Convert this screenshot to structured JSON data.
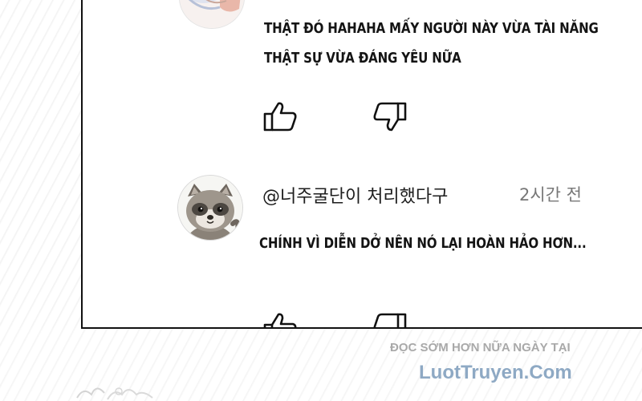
{
  "comments": [
    {
      "text_line1": "THẬT ĐÓ HAHAHA MẤY NGƯỜI NÀY VỪA TÀI NĂNG",
      "text_line2": "THẬT SỰ VỪA ĐÁNG YÊU NỮA",
      "actions": {
        "like_icon": "thumbs-up-icon",
        "dislike_icon": "thumbs-down-icon"
      }
    },
    {
      "username": "@너주굴단이 처리했다구",
      "timestamp": "2시간 전",
      "text": "CHÍNH VÌ DIỄN DỞ NÊN NÓ LẠI HOÀN HẢO HƠN...",
      "avatar_icon": "raccoon-avatar-icon",
      "actions": {
        "like_icon": "thumbs-up-icon",
        "dislike_icon": "thumbs-down-icon"
      }
    }
  ],
  "watermark": {
    "line1": "ĐỌC SỚM HƠN NỮA NGÀY TẠI",
    "line2": "LuotTruyen.Com"
  },
  "colors": {
    "text": "#141414",
    "timestamp": "#777777",
    "watermark_line1": "#a9a9a9",
    "watermark_line2": "#8ea9c4"
  }
}
